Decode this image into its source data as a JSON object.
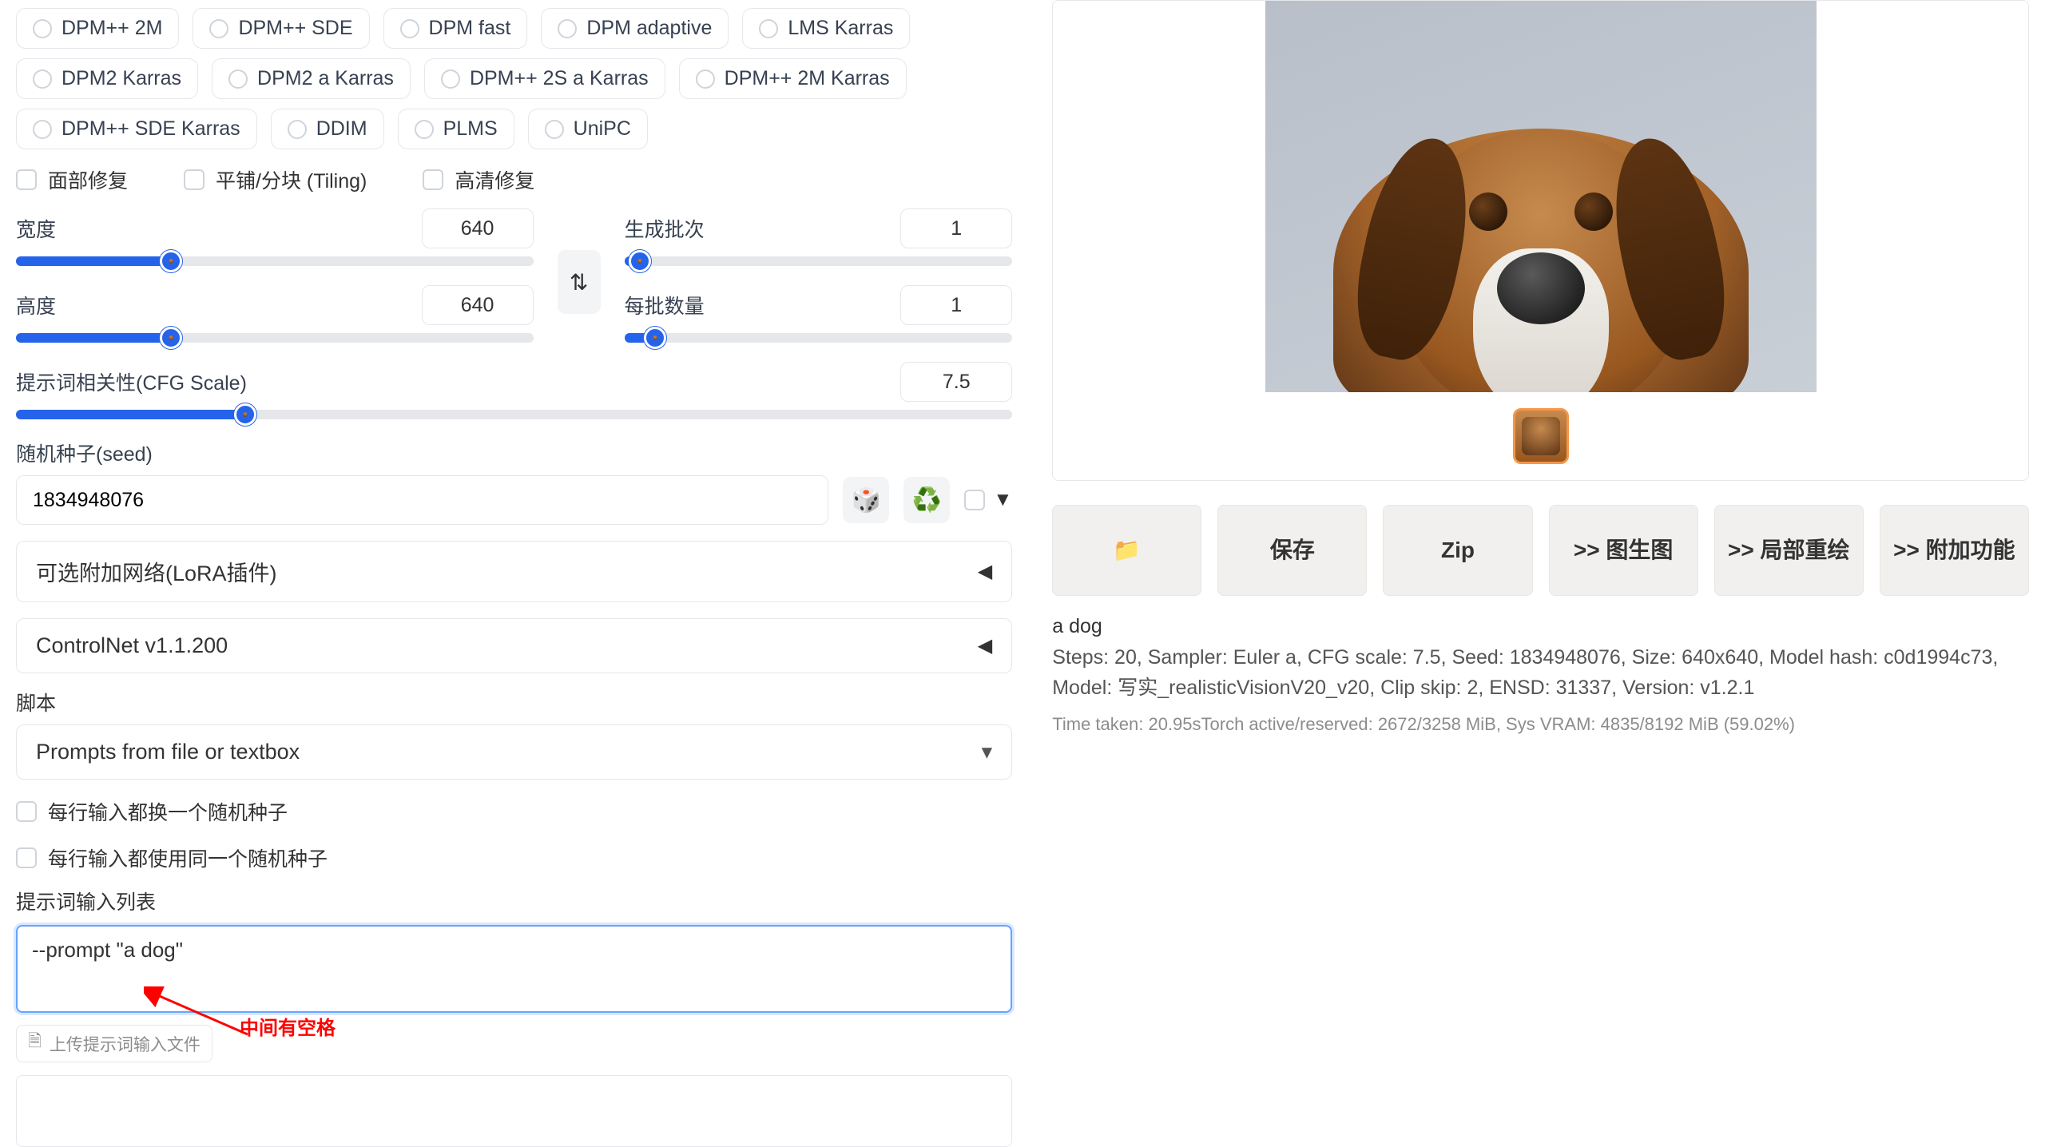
{
  "samplers_row1": [
    "DPM++ 2M",
    "DPM++ SDE",
    "DPM fast",
    "DPM adaptive",
    "LMS Karras"
  ],
  "samplers_row2": [
    "DPM2 Karras",
    "DPM2 a Karras",
    "DPM++ 2S a Karras",
    "DPM++ 2M Karras"
  ],
  "samplers_row3": [
    "DPM++ SDE Karras",
    "DDIM",
    "PLMS",
    "UniPC"
  ],
  "checks": {
    "face": "面部修复",
    "tiling": "平铺/分块 (Tiling)",
    "hires": "高清修复"
  },
  "width": {
    "label": "宽度",
    "value": "640"
  },
  "height": {
    "label": "高度",
    "value": "640"
  },
  "batch_count": {
    "label": "生成批次",
    "value": "1"
  },
  "batch_size": {
    "label": "每批数量",
    "value": "1"
  },
  "cfg": {
    "label": "提示词相关性(CFG Scale)",
    "value": "7.5"
  },
  "seed": {
    "label": "随机种子(seed)",
    "value": "1834948076"
  },
  "extra": {
    "label": "▼"
  },
  "lora": {
    "label": "可选附加网络(LoRA插件)"
  },
  "controlnet": {
    "label": "ControlNet v1.1.200"
  },
  "script_label": "脚本",
  "script_value": "Prompts from file or textbox",
  "iterate_seed": "每行输入都换一个随机种子",
  "same_seed": "每行输入都使用同一个随机种子",
  "prompt_list_label": "提示词输入列表",
  "prompt_list_value": "--prompt \"a dog\"",
  "upload_label": "上传提示词输入文件",
  "annotation": "中间有空格",
  "output_prompt": "a dog",
  "output_meta": "Steps: 20, Sampler: Euler a, CFG scale: 7.5, Seed: 1834948076, Size: 640x640, Model hash: c0d1994c73, Model: 写实_realisticVisionV20_v20, Clip skip: 2, ENSD: 31337, Version: v1.2.1",
  "time_taken": "Time taken: 20.95sTorch active/reserved: 2672/3258 MiB, Sys VRAM: 4835/8192 MiB (59.02%)",
  "actions": {
    "folder": "📁",
    "save": "保存",
    "zip": "Zip",
    "img2img": ">> 图生图",
    "inpaint": ">> 局部重绘",
    "extras": ">> 附加功能"
  }
}
